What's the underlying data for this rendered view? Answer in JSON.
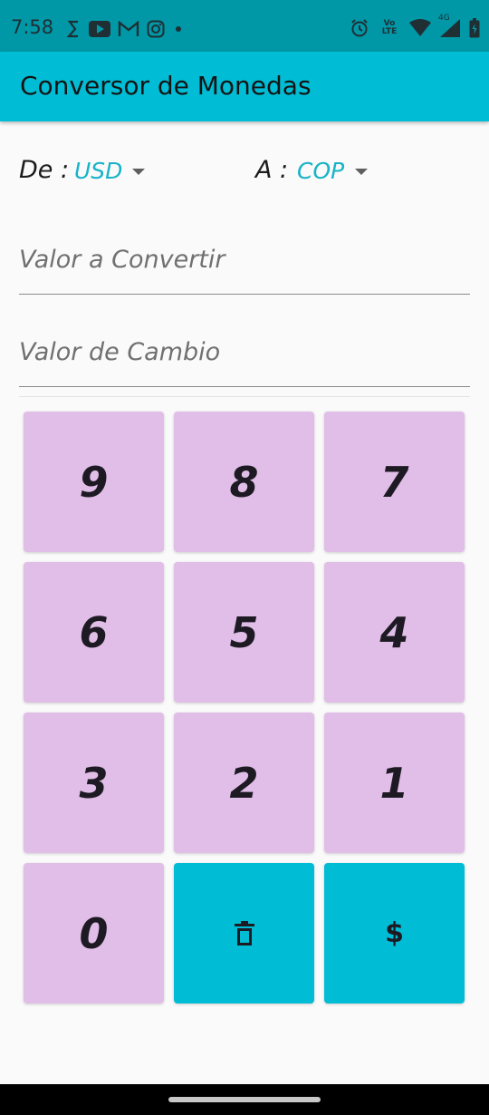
{
  "status_bar": {
    "time": "7:58",
    "network_label_volte": "Vo LTE",
    "network_label_4g": "4G",
    "left_icons": [
      "s-icon",
      "youtube-icon",
      "gmail-icon",
      "instagram-icon",
      "dot-icon"
    ],
    "right_icons": [
      "alarm-icon",
      "volte-icon",
      "wifi-icon",
      "signal-icon",
      "battery-icon"
    ]
  },
  "app_bar": {
    "title": "Conversor de Monedas",
    "color": "#00bcd4"
  },
  "converter": {
    "from_label": "De :",
    "from_currency": "USD",
    "to_label": "A :",
    "to_currency": "COP",
    "amount_placeholder": "Valor a Convertir",
    "amount_value": "",
    "rate_placeholder": "Valor de Cambio",
    "rate_value": ""
  },
  "keypad": {
    "digit_color": "#e1bee7",
    "action_color": "#00bcd4",
    "digits": [
      "9",
      "8",
      "7",
      "6",
      "5",
      "4",
      "3",
      "2",
      "1",
      "0"
    ],
    "delete_icon": "trash-icon",
    "convert_label": "$"
  }
}
